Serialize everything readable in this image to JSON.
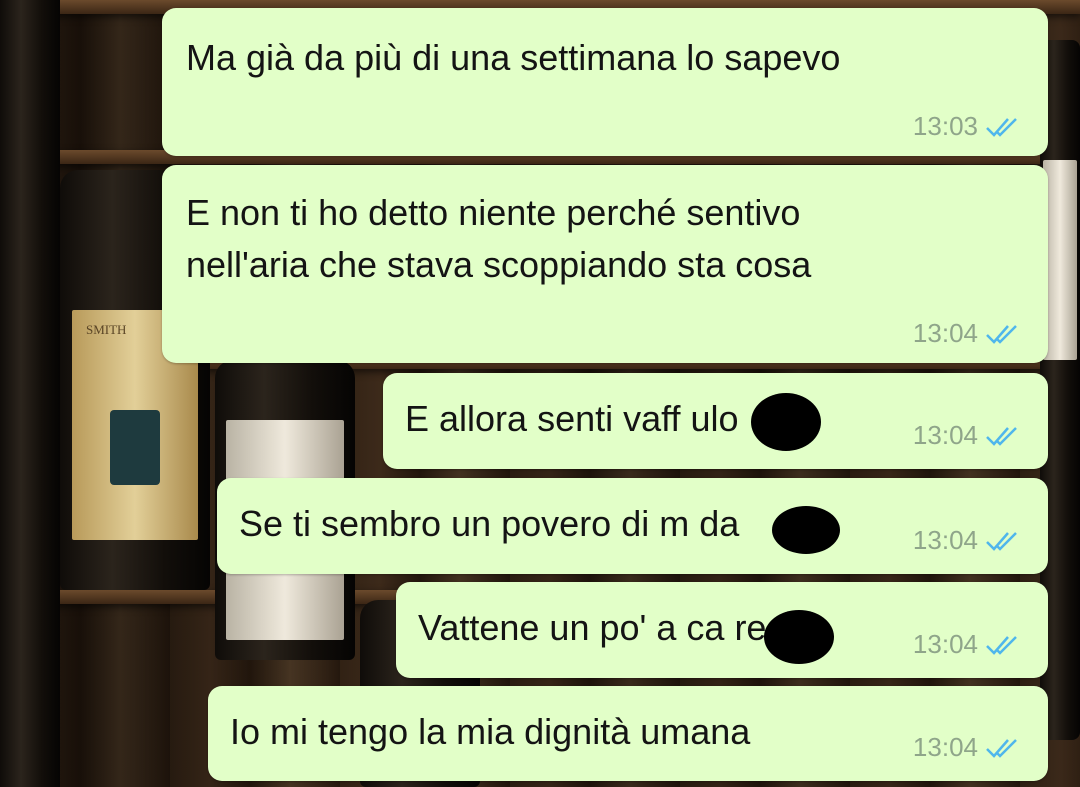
{
  "messages": [
    {
      "text": "Ma già da più di una settimana lo sapevo",
      "time": "13:03",
      "status_icon": "double-check-icon",
      "status": "read"
    },
    {
      "text": "E non ti ho detto niente perché sentivo\nnell'aria che stava scoppiando sta cosa",
      "time": "13:04",
      "status_icon": "double-check-icon",
      "status": "read"
    },
    {
      "text": "E allora senti vaff    ulo",
      "time": "13:04",
      "status_icon": "double-check-icon",
      "status": "read"
    },
    {
      "text": "Se ti sembro un povero di m    da",
      "time": "13:04",
      "status_icon": "double-check-icon",
      "status": "read"
    },
    {
      "text": "Vattene un po' a ca    re",
      "time": "13:04",
      "status_icon": "double-check-icon",
      "status": "read"
    },
    {
      "text": "Io mi tengo la mia dignità umana",
      "time": "13:04",
      "status_icon": "double-check-icon",
      "status": "read"
    }
  ],
  "colors": {
    "outgoing_bubble": "#e2ffc8",
    "read_ticks": "#4fb6ec",
    "timestamp": "#8fa58a",
    "redaction": "#000000"
  },
  "background_image": "wine-bottles-shelf",
  "bottle_label_text": "SMITH"
}
